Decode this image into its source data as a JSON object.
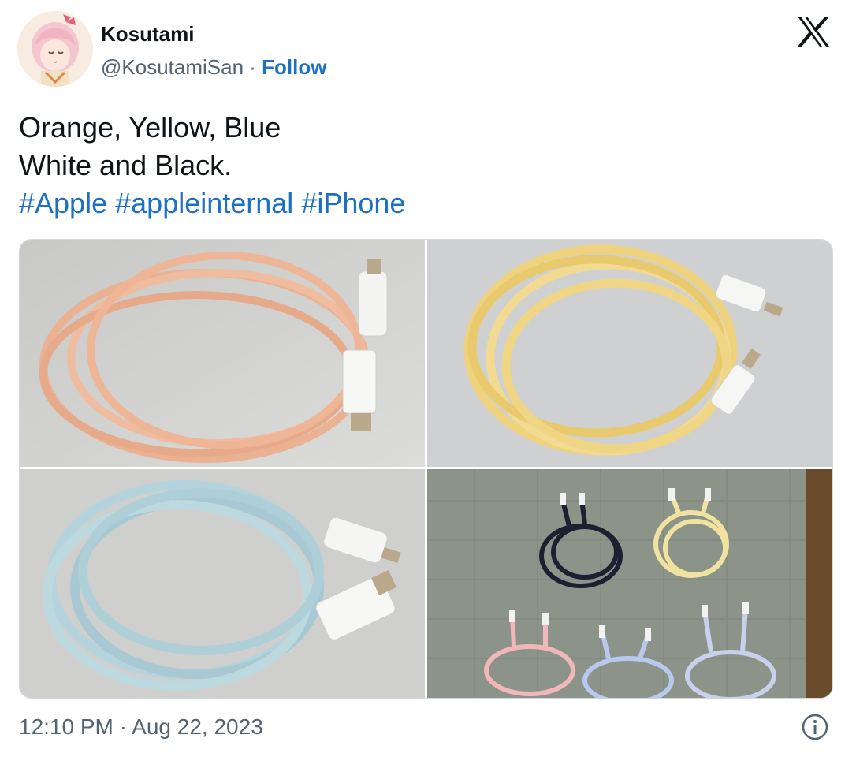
{
  "author": {
    "display_name": "Kosutami",
    "handle": "@KosutamiSan",
    "separator": " · ",
    "follow_label": "Follow",
    "avatar_icon": "anime-girl-avatar"
  },
  "brand_icon": "x-logo-icon",
  "tweet": {
    "lines": [
      "Orange, Yellow, Blue",
      "White and Black."
    ],
    "hashtags": [
      "#Apple",
      "#appleinternal",
      "#iPhone"
    ]
  },
  "media": [
    {
      "subject": "orange braided USB-C cable",
      "cable_color": "#f0b08e"
    },
    {
      "subject": "yellow braided USB-C cable",
      "cable_color": "#efd583"
    },
    {
      "subject": "blue braided USB-C cable",
      "cable_color": "#b3d2da"
    },
    {
      "subject": "five colored USB-C cables on tarp",
      "cable_color": "#1c2030"
    }
  ],
  "footer": {
    "timestamp": "12:10 PM · Aug 22, 2023",
    "info_icon": "info-icon"
  },
  "colors": {
    "link": "#1d70c4",
    "secondary_text": "#536471",
    "primary_text": "#0f1419"
  }
}
